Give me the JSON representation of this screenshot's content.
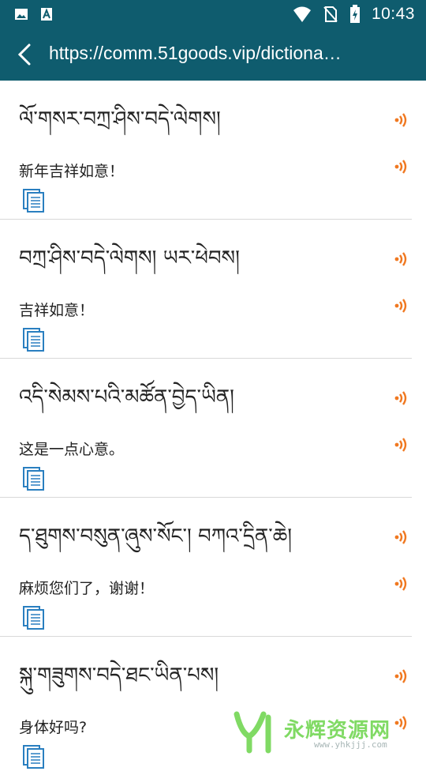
{
  "status_bar": {
    "time": "10:43",
    "left_icons": [
      "image-icon",
      "text-a-icon"
    ],
    "right_icons": [
      "wifi-icon",
      "no-sim-icon",
      "battery-charging-icon"
    ]
  },
  "app_bar": {
    "url": "https://comm.51goods.vip/dictiona…",
    "back_icon": "chevron-left-icon"
  },
  "entries": [
    {
      "tibetan": "ལོ་གསར་བཀྲ་ཤིས་བདེ་ལེགས།",
      "chinese": "新年吉祥如意！"
    },
    {
      "tibetan": "བཀྲ་ཤིས་བདེ་ལེགས། ཡར་ཕེབས།",
      "chinese": "吉祥如意！"
    },
    {
      "tibetan": "འདི་སེམས་པའི་མཚོན་བྱེད་ཡིན།",
      "chinese": "这是一点心意。"
    },
    {
      "tibetan": "ད་ཐུགས་བསུན་ཞུས་སོང་། བཀའ་དྲིན་ཆེ།",
      "chinese": "麻烦您们了，谢谢！"
    },
    {
      "tibetan": "སྐུ་གཟུགས་བདེ་ཐང་ཡིན་པས།",
      "chinese": "身体好吗?"
    }
  ],
  "watermark": {
    "text": "永辉资源网",
    "url": "www.yhkjjj.com"
  },
  "colors": {
    "header": "#0f5c6e",
    "speaker": "#f07820",
    "doc_icon": "#2a7fc0",
    "watermark": "#6bd44a"
  }
}
